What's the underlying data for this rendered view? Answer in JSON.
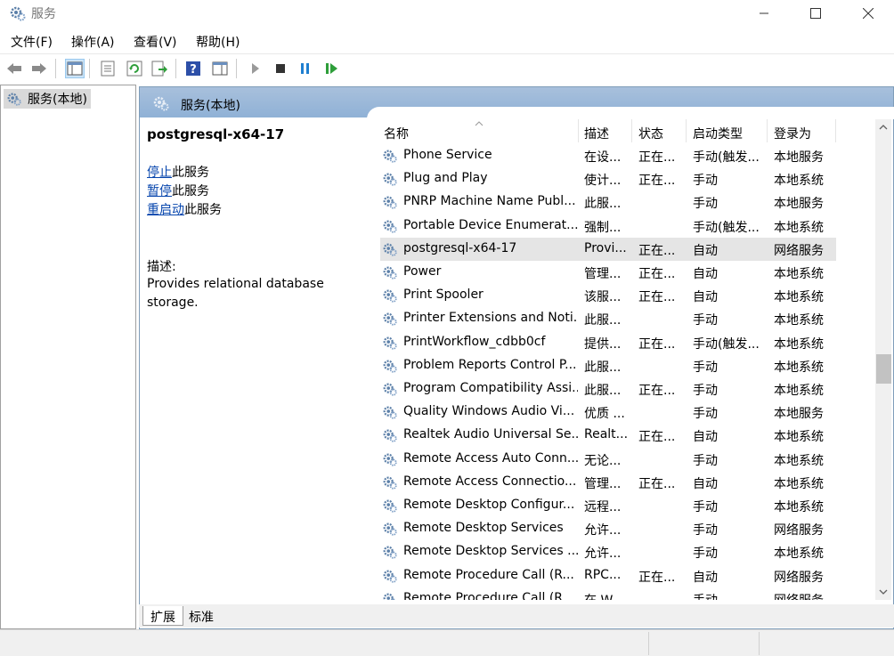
{
  "window": {
    "title": "服务"
  },
  "menu": [
    "文件(F)",
    "操作(A)",
    "查看(V)",
    "帮助(H)"
  ],
  "toolbar": {
    "icons": [
      "back-icon",
      "forward-icon",
      "show-hide-console-tree-icon",
      "properties-icon",
      "refresh-icon",
      "export-list-icon",
      "help-icon",
      "show-action-pane-icon",
      "start-service-icon",
      "stop-service-icon",
      "pause-service-icon",
      "resume-service-icon"
    ]
  },
  "tree": {
    "item_label": "服务(本地)"
  },
  "panel": {
    "header": "服务(本地)"
  },
  "details": {
    "service_name": "postgresql-x64-17",
    "stop_link": "停止",
    "stop_suffix": "此服务",
    "pause_link": "暂停",
    "pause_suffix": "此服务",
    "restart_link": "重启动",
    "restart_suffix": "此服务",
    "desc_label": "描述:",
    "desc_text": "Provides relational database storage."
  },
  "list": {
    "columns": [
      "名称",
      "描述",
      "状态",
      "启动类型",
      "登录为"
    ],
    "selected_index": 4,
    "rows": [
      [
        "Phone Service",
        "在设...",
        "正在...",
        "手动(触发...",
        "本地服务"
      ],
      [
        "Plug and Play",
        "使计...",
        "正在...",
        "手动",
        "本地系统"
      ],
      [
        "PNRP Machine Name Publ...",
        "此服...",
        "",
        "手动",
        "本地服务"
      ],
      [
        "Portable Device Enumerat...",
        "强制...",
        "",
        "手动(触发...",
        "本地系统"
      ],
      [
        "postgresql-x64-17",
        "Provi...",
        "正在...",
        "自动",
        "网络服务"
      ],
      [
        "Power",
        "管理...",
        "正在...",
        "自动",
        "本地系统"
      ],
      [
        "Print Spooler",
        "该服...",
        "正在...",
        "自动",
        "本地系统"
      ],
      [
        "Printer Extensions and Noti...",
        "此服...",
        "",
        "手动",
        "本地系统"
      ],
      [
        "PrintWorkflow_cdbb0cf",
        "提供...",
        "正在...",
        "手动(触发...",
        "本地系统"
      ],
      [
        "Problem Reports Control P...",
        "此服...",
        "",
        "手动",
        "本地系统"
      ],
      [
        "Program Compatibility Assi...",
        "此服...",
        "正在...",
        "手动",
        "本地系统"
      ],
      [
        "Quality Windows Audio Vi...",
        "优质 ...",
        "",
        "手动",
        "本地服务"
      ],
      [
        "Realtek Audio Universal Se...",
        "Realt...",
        "正在...",
        "自动",
        "本地系统"
      ],
      [
        "Remote Access Auto Conn...",
        "无论...",
        "",
        "手动",
        "本地系统"
      ],
      [
        "Remote Access Connectio...",
        "管理...",
        "正在...",
        "自动",
        "本地系统"
      ],
      [
        "Remote Desktop Configur...",
        "远程...",
        "",
        "手动",
        "本地系统"
      ],
      [
        "Remote Desktop Services",
        "允许...",
        "",
        "手动",
        "网络服务"
      ],
      [
        "Remote Desktop Services ...",
        "允许...",
        "",
        "手动",
        "本地系统"
      ],
      [
        "Remote Procedure Call (R...",
        "RPC...",
        "正在...",
        "自动",
        "网络服务"
      ],
      [
        "Remote Procedure Call (R...",
        "在 W...",
        "",
        "手动",
        "网络服务"
      ]
    ]
  },
  "bottom_tabs": [
    "扩展",
    "标准"
  ],
  "colors": {
    "link": "#0645ad",
    "header_gradient_top": "#a8c0dc",
    "header_gradient_bottom": "#8fb1d6",
    "selected_row": "#e5e5e5"
  }
}
